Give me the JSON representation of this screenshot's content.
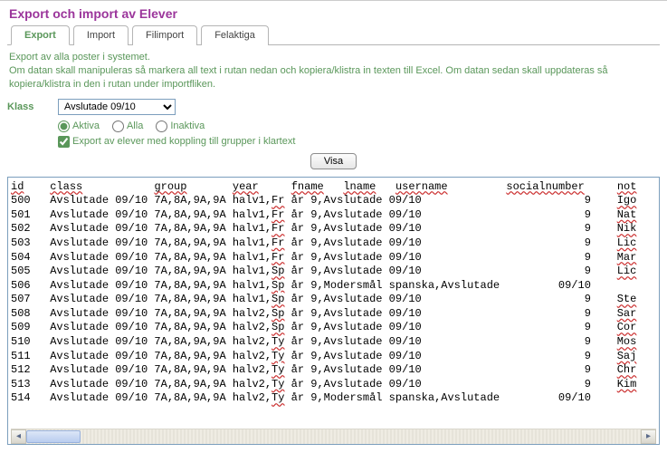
{
  "title": "Export och import av Elever",
  "tabs": [
    {
      "label": "Export",
      "active": true
    },
    {
      "label": "Import",
      "active": false
    },
    {
      "label": "Filimport",
      "active": false
    },
    {
      "label": "Felaktiga",
      "active": false
    }
  ],
  "desc_line1": "Export av alla poster i systemet.",
  "desc_line2": "Om datan skall manipuleras så markera all text i rutan nedan och kopiera/klistra in texten till Excel. Om datan sedan skall uppdateras så kopiera/klistra in den i rutan under importfliken.",
  "klass_label": "Klass",
  "klass_value": "Avslutade 09/10",
  "radios": {
    "aktiva": "Aktiva",
    "alla": "Alla",
    "inaktiva": "Inaktiva"
  },
  "checkbox_label": "Export av elever med koppling till grupper i klartext",
  "visa_label": "Visa",
  "columns": [
    "id",
    "class",
    "group",
    "year",
    "fname",
    "lname",
    "username",
    "socialnumber",
    "not"
  ],
  "rows": [
    {
      "id": "500",
      "class": "Avslutade 09/10",
      "group": "7A,8A,9A,9A",
      "year": "halv1,Fr",
      "fname": "år",
      "lname": "9,Avslutade 09/10",
      "username": "",
      "social": "9",
      "not": "Igo"
    },
    {
      "id": "501",
      "class": "Avslutade 09/10",
      "group": "7A,8A,9A,9A",
      "year": "halv1,Fr",
      "fname": "år",
      "lname": "9,Avslutade 09/10",
      "username": "",
      "social": "9",
      "not": "Nat"
    },
    {
      "id": "502",
      "class": "Avslutade 09/10",
      "group": "7A,8A,9A,9A",
      "year": "halv1,Fr",
      "fname": "år",
      "lname": "9,Avslutade 09/10",
      "username": "",
      "social": "9",
      "not": "Nik"
    },
    {
      "id": "503",
      "class": "Avslutade 09/10",
      "group": "7A,8A,9A,9A",
      "year": "halv1,Fr",
      "fname": "år",
      "lname": "9,Avslutade 09/10",
      "username": "",
      "social": "9",
      "not": "Lic"
    },
    {
      "id": "504",
      "class": "Avslutade 09/10",
      "group": "7A,8A,9A,9A",
      "year": "halv1,Fr",
      "fname": "år",
      "lname": "9,Avslutade 09/10",
      "username": "",
      "social": "9",
      "not": "Mar"
    },
    {
      "id": "505",
      "class": "Avslutade 09/10",
      "group": "7A,8A,9A,9A",
      "year": "halv1,Sp",
      "fname": "år",
      "lname": "9,Avslutade 09/10",
      "username": "",
      "social": "9",
      "not": "Lic"
    },
    {
      "id": "506",
      "class": "Avslutade 09/10",
      "group": "7A,8A,9A,9A",
      "year": "halv1,Sp",
      "fname": "år",
      "lname": "9,Modersmål spanska,Avslutade",
      "username": "",
      "social": "09/10",
      "not": ""
    },
    {
      "id": "507",
      "class": "Avslutade 09/10",
      "group": "7A,8A,9A,9A",
      "year": "halv1,Sp",
      "fname": "år",
      "lname": "9,Avslutade 09/10",
      "username": "",
      "social": "9",
      "not": "Ste"
    },
    {
      "id": "508",
      "class": "Avslutade 09/10",
      "group": "7A,8A,9A,9A",
      "year": "halv2,Sp",
      "fname": "år",
      "lname": "9,Avslutade 09/10",
      "username": "",
      "social": "9",
      "not": "Sar"
    },
    {
      "id": "509",
      "class": "Avslutade 09/10",
      "group": "7A,8A,9A,9A",
      "year": "halv2,Sp",
      "fname": "år",
      "lname": "9,Avslutade 09/10",
      "username": "",
      "social": "9",
      "not": "Cor"
    },
    {
      "id": "510",
      "class": "Avslutade 09/10",
      "group": "7A,8A,9A,9A",
      "year": "halv2,Ty",
      "fname": "år",
      "lname": "9,Avslutade 09/10",
      "username": "",
      "social": "9",
      "not": "Mos"
    },
    {
      "id": "511",
      "class": "Avslutade 09/10",
      "group": "7A,8A,9A,9A",
      "year": "halv2,Ty",
      "fname": "år",
      "lname": "9,Avslutade 09/10",
      "username": "",
      "social": "9",
      "not": "Saj"
    },
    {
      "id": "512",
      "class": "Avslutade 09/10",
      "group": "7A,8A,9A,9A",
      "year": "halv2,Ty",
      "fname": "år",
      "lname": "9,Avslutade 09/10",
      "username": "",
      "social": "9",
      "not": "Chr"
    },
    {
      "id": "513",
      "class": "Avslutade 09/10",
      "group": "7A,8A,9A,9A",
      "year": "halv2,Ty",
      "fname": "år",
      "lname": "9,Avslutade 09/10",
      "username": "",
      "social": "9",
      "not": "Kim"
    },
    {
      "id": "514",
      "class": "Avslutade 09/10",
      "group": "7A,8A,9A,9A",
      "year": "halv2,Ty",
      "fname": "år",
      "lname": "9,Modersmål spanska,Avslutade",
      "username": "",
      "social": "09/10",
      "not": ""
    }
  ]
}
